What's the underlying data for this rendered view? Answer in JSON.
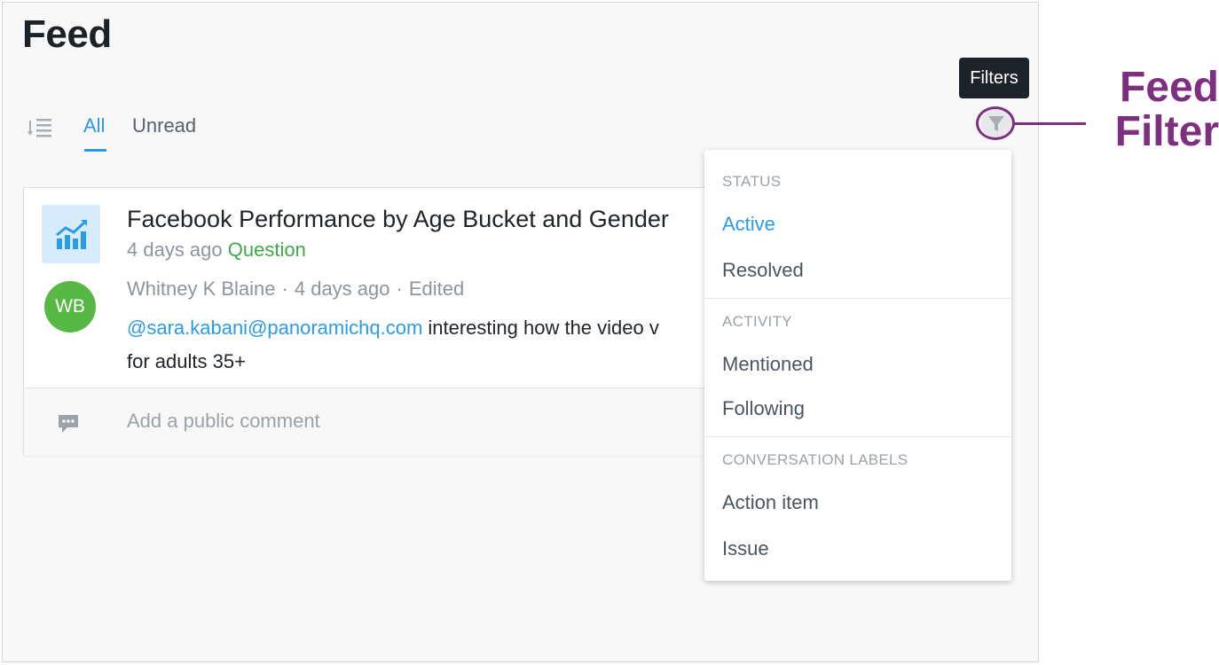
{
  "header": {
    "title": "Feed"
  },
  "tabs": [
    {
      "label": "All",
      "active": true
    },
    {
      "label": "Unread",
      "active": false
    }
  ],
  "card": {
    "title": "Facebook Performance by Age Bucket and Gender",
    "time": "4 days ago",
    "type": "Question",
    "comment": {
      "avatar_initials": "WB",
      "author": "Whitney K Blaine",
      "time": "4 days ago",
      "status": "Edited",
      "mention": "@sara.kabani@panoramichq.com",
      "text": " interesting how the video v",
      "text_line2": "for adults 35+"
    },
    "comment_input": {
      "placeholder": "Add a public comment"
    }
  },
  "tooltip": {
    "text": "Filters"
  },
  "annotation": {
    "line1": "Feed",
    "line2": "Filter",
    "color": "#7f2f7f"
  },
  "filters": {
    "sections": [
      {
        "header": "STATUS",
        "items": [
          {
            "label": "Active",
            "active": true
          },
          {
            "label": "Resolved",
            "active": false
          }
        ]
      },
      {
        "header": "ACTIVITY",
        "items": [
          {
            "label": "Mentioned",
            "active": false
          },
          {
            "label": "Following",
            "active": false
          }
        ]
      },
      {
        "header": "CONVERSATION LABELS",
        "items": [
          {
            "label": "Action item",
            "active": false
          },
          {
            "label": "Issue",
            "active": false
          }
        ]
      }
    ]
  },
  "icons": {
    "sort": "sort-descending-icon",
    "chart": "trending-chart-icon",
    "comment": "comment-bubble-icon",
    "filter": "filter-funnel-icon"
  },
  "colors": {
    "accent": "#2a9be8",
    "question": "#3fa94a",
    "avatar": "#58b846",
    "annotation": "#7f2f7f"
  }
}
